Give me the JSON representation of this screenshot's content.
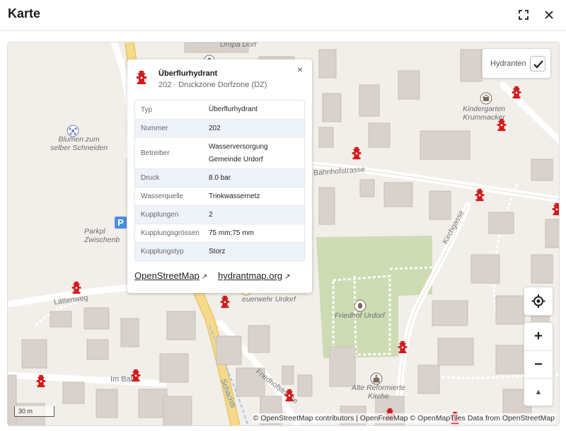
{
  "header": {
    "title": "Karte"
  },
  "map": {
    "labels": {
      "dropa_dorf": "Dropa Dorf",
      "blumen": "Blumen zum\nselber Schneiden",
      "parkplatz": "Parkpl\nZwischenb",
      "kindergarten": "Kindergarten\nKrummacker",
      "feuerwehr": "euerwehr Urdorf",
      "friedhof": "Friedhof Urdorf",
      "kirche": "Alte Reformierte\nKirche"
    },
    "streets": {
      "bahnhofstrasse": "Bahnhofstrasse",
      "lattenweg": "Lättenweg",
      "kirchgasse": "Kirchgasse",
      "im_baltz": "Im Baltz",
      "friedhofstrasse": "Friedhofstrasse",
      "schachtli": "Schächtli"
    },
    "parking_symbol": "P",
    "scale": "30 m",
    "attribution": "© OpenStreetMap contributors | OpenFreeMap © OpenMapTiles Data from OpenStreetMap",
    "layer_control": {
      "label": "Hydranten",
      "checked": true
    },
    "controls": {
      "zoom_in": "+",
      "zoom_out": "−",
      "compass": "▲"
    }
  },
  "popup": {
    "close": "×",
    "title": "Überflurhydrant",
    "subtitle": "202 · Druckzone Dorfzone (DZ)",
    "rows": [
      {
        "key": "Typ",
        "value": "Überflurhydrant"
      },
      {
        "key": "Nummer",
        "value": "202"
      },
      {
        "key": "Betreiber",
        "value": "Wasserversorgung\nGemeinde Urdorf"
      },
      {
        "key": "Druck",
        "value": "8.0 bar"
      },
      {
        "key": "Wasserquelle",
        "value": "Trinkwassernetz"
      },
      {
        "key": "Kupplungen",
        "value": "2"
      },
      {
        "key": "Kupplungsgrössen",
        "value": "75 mm;75 mm"
      },
      {
        "key": "Kupplungstyp",
        "value": "Storz"
      }
    ],
    "links": {
      "osm": "OpenStreetMap",
      "hydrantmap": "hydrantmap.org"
    }
  },
  "colors": {
    "hydrant": "#d01c1c",
    "park": "#cddcb3",
    "road_yellow": "#f6d98a",
    "water": "#9fc6e8",
    "building": "#d9d2cc"
  }
}
